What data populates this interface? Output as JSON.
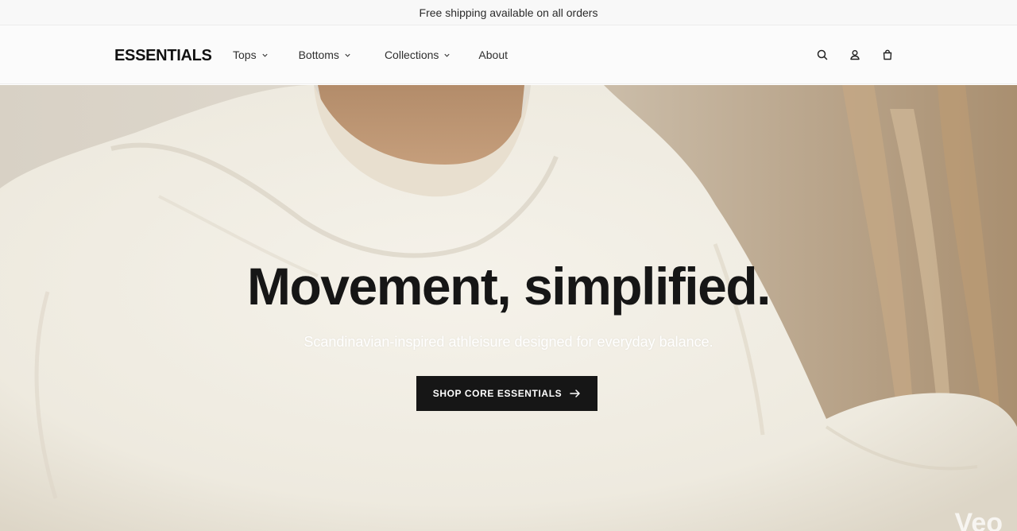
{
  "announcement": {
    "text": "Free shipping available on all orders"
  },
  "header": {
    "logo": "ESSENTIALS",
    "nav": [
      {
        "label": "Tops",
        "has_dropdown": true
      },
      {
        "label": "Bottoms",
        "has_dropdown": true
      },
      {
        "label": "Collections",
        "has_dropdown": true
      },
      {
        "label": "About",
        "has_dropdown": false
      }
    ],
    "icons": [
      "search-icon",
      "account-icon",
      "cart-icon"
    ]
  },
  "hero": {
    "title": "Movement, simplified.",
    "subtitle": "Scandinavian-inspired athleisure designed for everyday balance.",
    "cta_label": "SHOP CORE ESSENTIALS",
    "cta_icon": "arrow-right-icon",
    "watermark": "Veo"
  },
  "colors": {
    "cta_background": "#161616",
    "title_color": "#161616",
    "header_background": "#fbfbfb"
  }
}
